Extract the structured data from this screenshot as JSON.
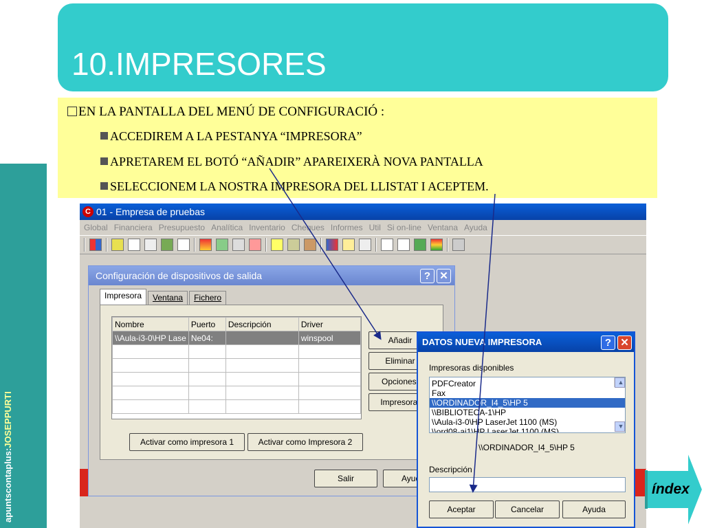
{
  "slide": {
    "title": "10.IMPRESORES",
    "side_label_a": "apuntscontaplus:",
    "side_label_b": "JOSEPPURTI",
    "bullet_main": "EN LA PANTALLA DEL MENÚ DE CONFIGURACIÓ :",
    "bullets": [
      "ACCEDIREM A LA PESTANYA “IMPRESORA”",
      "APRETAREM EL BOTÓ “AÑADIR” APAREIXERÀ NOVA PANTALLA",
      "SELECCIONEM LA NOSTRA IMPRESORA DEL LLISTAT I ACEPTEM."
    ],
    "index_label": "índex"
  },
  "app": {
    "title": "01 - Empresa de pruebas",
    "menu": [
      "Global",
      "Financiera",
      "Presupuesto",
      "Analítica",
      "Inventario",
      "Cheques",
      "Informes",
      "Util",
      "Si on-line",
      "Ventana",
      "Ayuda"
    ],
    "bottom_buttons": {
      "salir": "Salir",
      "ayuda": "Ayud"
    }
  },
  "config_dialog": {
    "title": "Configuración de dispositivos de salida",
    "tabs": [
      "Impresora",
      "Ventana",
      "Fichero"
    ],
    "columns": [
      "Nombre",
      "Puerto",
      "Descripción",
      "Driver"
    ],
    "row": {
      "nombre": "\\\\Aula-i3-0\\HP Lase",
      "puerto": "Ne04:",
      "descripcion": "",
      "driver": "winspool"
    },
    "buttons": {
      "anadir": "Añadir",
      "eliminar": "Eliminar",
      "opciones": "Opciones.",
      "impresora": "Impresora.",
      "activar1": "Activar como impresora 1",
      "activar2": "Activar como Impresora 2"
    }
  },
  "nueva_dialog": {
    "title": "DATOS NUEVA IMPRESORA",
    "list_label": "Impresoras disponibles",
    "printers": [
      "PDFCreator",
      "Fax",
      "\\\\ORDINADOR_I4_5\\HP 5",
      "\\\\BIBLIOTECA-1\\HP",
      "\\\\Aula-i3-0\\HP LaserJet 1100 (MS)",
      "\\\\ord08-ai1\\HP LaserJet 1100 (MS)"
    ],
    "selected_printer": "\\\\ORDINADOR_I4_5\\HP 5",
    "desc_label": "Descripción",
    "desc_value": "",
    "buttons": {
      "aceptar": "Aceptar",
      "cancelar": "Cancelar",
      "ayuda": "Ayuda"
    }
  },
  "colors": {
    "teal": "#33cccc",
    "yellow": "#ffff99",
    "sidebar": "#2d9f9a",
    "red": "#d9251c"
  }
}
